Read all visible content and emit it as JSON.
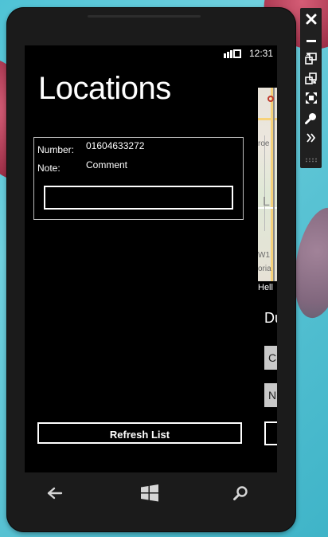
{
  "status_bar": {
    "time": "12:31",
    "icons": [
      "signal-icon"
    ]
  },
  "page": {
    "title": "Locations"
  },
  "list": {
    "items": [
      {
        "number_label": "Number:",
        "number_value": "01604633272",
        "note_label": "Note:",
        "note_value": "Comment",
        "input_value": ""
      }
    ]
  },
  "actions": {
    "refresh_label": "Refresh List"
  },
  "next_panel_peek": {
    "caption": "Hell",
    "heading": "Du",
    "field_1": "C",
    "field_2": "N",
    "map_labels": [
      "roe",
      "L",
      "W1",
      "oria"
    ]
  },
  "nav_bar": {
    "icons": [
      "back-arrow-icon",
      "windows-logo-icon",
      "search-icon"
    ]
  },
  "emulator_toolbar": {
    "icons": [
      "close-icon",
      "minimize-icon",
      "rotate-left-icon",
      "rotate-right-icon",
      "fit-to-screen-icon",
      "zoom-icon",
      "additional-tools-icon"
    ]
  },
  "colors": {
    "screen_background": "#000000",
    "foreground": "#ffffff",
    "list_item_border": "#bdbdbd",
    "phone_body": "#1b1b1b",
    "desktop_background": "#58c2d3"
  }
}
